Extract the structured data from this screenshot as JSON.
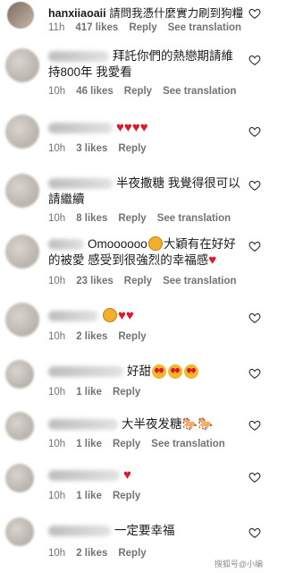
{
  "top": {
    "username": "hanxiiaoaii",
    "text": "請問我憑什麼實力刷到狗糧的文案",
    "time": "11h",
    "likes": "417 likes",
    "reply": "Reply",
    "see_translation": "See translation"
  },
  "comments": [
    {
      "text": "拜託你們的熱戀期請維持800年 我愛看",
      "time": "10h",
      "likes": "46 likes",
      "reply": "Reply",
      "see_translation": "See translation"
    },
    {
      "text": "",
      "time": "10h",
      "likes": "3 likes",
      "reply": "Reply"
    },
    {
      "text": "半夜撒糖 我覺得很可以 請繼續",
      "time": "10h",
      "likes": "8 likes",
      "reply": "Reply",
      "see_translation": "See translation"
    },
    {
      "text_a": "Omoooooo",
      "text_b": "大穎有在好好的被愛 感受到很強烈的幸福感",
      "time": "10h",
      "likes": "23 likes",
      "reply": "Reply",
      "see_translation": "See translation"
    },
    {
      "text": "",
      "time": "10h",
      "likes": "2 likes",
      "reply": "Reply"
    },
    {
      "text": "好甜",
      "time": "10h",
      "likes": "1 like",
      "reply": "Reply"
    },
    {
      "text": "大半夜发糖",
      "time": "10h",
      "likes": "1 like",
      "reply": "Reply",
      "see_translation": "See translation"
    },
    {
      "text": "",
      "time": "10h",
      "likes": "1 like",
      "reply": "Reply"
    },
    {
      "text": "一定要幸福",
      "time": "10h",
      "likes": "2 likes",
      "reply": "Reply"
    }
  ],
  "watermark": "搜狐号@小编"
}
